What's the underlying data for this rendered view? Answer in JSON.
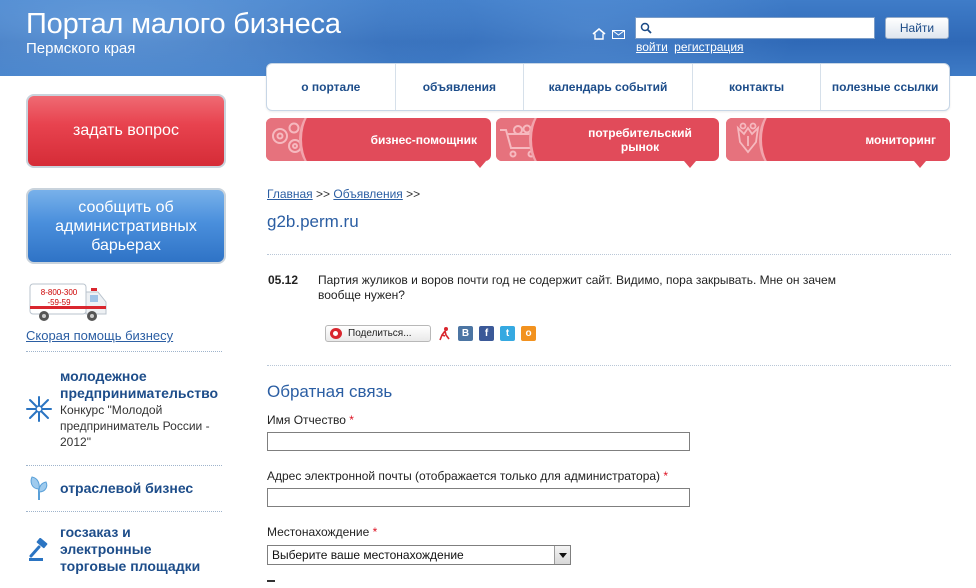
{
  "header": {
    "title": "Портал малого бизнеса",
    "subtitle": "Пермского края",
    "search": {
      "placeholder": "",
      "button_label": "Найти"
    },
    "auth": {
      "login": "войти",
      "register": "регистрация"
    }
  },
  "nav": {
    "items": [
      {
        "label": "о портале"
      },
      {
        "label": "объявления"
      },
      {
        "label": "календарь событий"
      },
      {
        "label": "контакты"
      },
      {
        "label": "полезные ссылки"
      }
    ]
  },
  "tabs": [
    {
      "label": "бизнес-помощник",
      "icon": "gears-icon"
    },
    {
      "label": "потребительский рынок",
      "icon": "shopping-cart-icon"
    },
    {
      "label": "мониторинг",
      "icon": "coat-of-arms-icon"
    }
  ],
  "sidebar": {
    "ask_button": "задать вопрос",
    "report_button": "сообщить об административных барьерах",
    "phone_line1": "8-800-300",
    "phone_line2": "-59-59",
    "emergency_link": "Скорая помощь бизнесу",
    "items": [
      {
        "title": "молодежное предпринимательство",
        "desc": "Конкурс \"Молодой предприниматель России - 2012\"",
        "icon": "snowflake-icon"
      },
      {
        "title": "отраслевой бизнес",
        "icon": "sprout-icon"
      },
      {
        "title": "госзаказ и электронные торговые площадки",
        "icon": "gavel-icon"
      }
    ]
  },
  "content": {
    "breadcrumb": {
      "home": "Главная",
      "sep": ">>",
      "section": "Объявления"
    },
    "page_title": "g2b.perm.ru",
    "news": {
      "date": "05.12",
      "text": "Партия жуликов и воров почти год не содержит сайт. Видимо, пора закрывать. Мне он зачем вообще нужен?"
    },
    "share": {
      "label": "Поделиться...",
      "networks": [
        "livejournal-icon",
        "vkontakte-icon",
        "facebook-icon",
        "twitter-icon",
        "odnoklassniki-icon"
      ]
    },
    "feedback": {
      "title": "Обратная связь",
      "name_label": "Имя Отчество",
      "email_label": "Адрес электронной почты (отображается только для администратора)",
      "location_label": "Местонахождение",
      "required_mark": "*",
      "location_select": "Выберите ваше местонахождение"
    }
  },
  "colors": {
    "header_blue": "#3072bd",
    "link_blue": "#2b5ea3",
    "tab_red": "#e14b5a",
    "ask_red": "#e8434f",
    "report_blue": "#4a8fdc"
  }
}
